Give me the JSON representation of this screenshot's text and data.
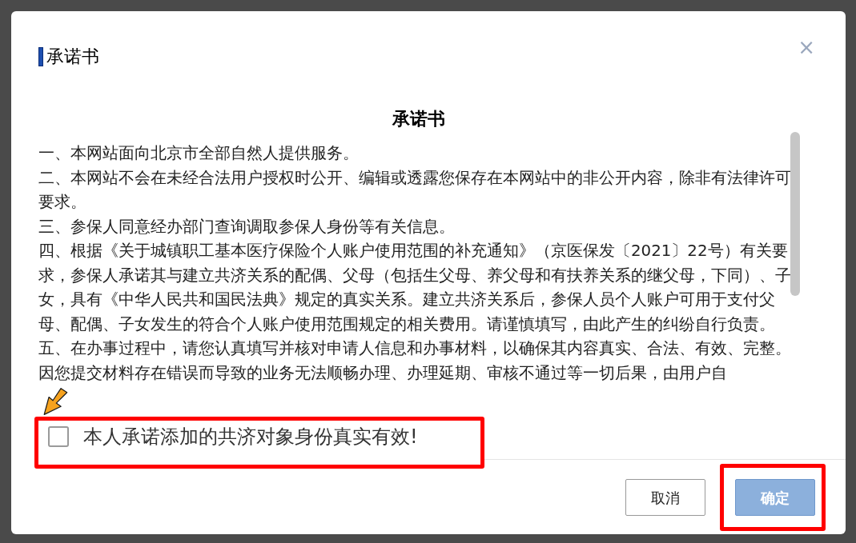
{
  "dialog": {
    "title": "承诺书",
    "close": "×"
  },
  "document": {
    "heading": "承诺书",
    "paragraphs": [
      "一、本网站面向北京市全部自然人提供服务。",
      "二、本网站不会在未经合法用户授权时公开、编辑或透露您保存在本网站中的非公开内容，除非有法律许可要求。",
      "三、参保人同意经办部门查询调取参保人身份等有关信息。",
      "四、根据《关于城镇职工基本医疗保险个人账户使用范围的补充通知》（京医保发〔2021〕22号）有关要求，参保人承诺其与建立共济关系的配偶、父母（包括生父母、养父母和有扶养关系的继父母，下同）、子女，具有《中华人民共和国民法典》规定的真实关系。建立共济关系后，参保人员个人账户可用于支付父母、配偶、子女发生的符合个人账户使用范围规定的相关费用。请谨慎填写，由此产生的纠纷自行负责。",
      "五、在办事过程中，请您认真填写并核对申请人信息和办事材料，以确保其内容真实、合法、有效、完整。因您提交材料存在错误而导致的业务无法顺畅办理、办理延期、审核不通过等一切后果，由用户自"
    ]
  },
  "agreement": {
    "label": "本人承诺添加的共济对象身份真实有效!",
    "checked": false
  },
  "buttons": [
    {
      "label": "取消",
      "kind": "secondary"
    },
    {
      "label": "确定",
      "kind": "primary",
      "disabled": true
    }
  ]
}
